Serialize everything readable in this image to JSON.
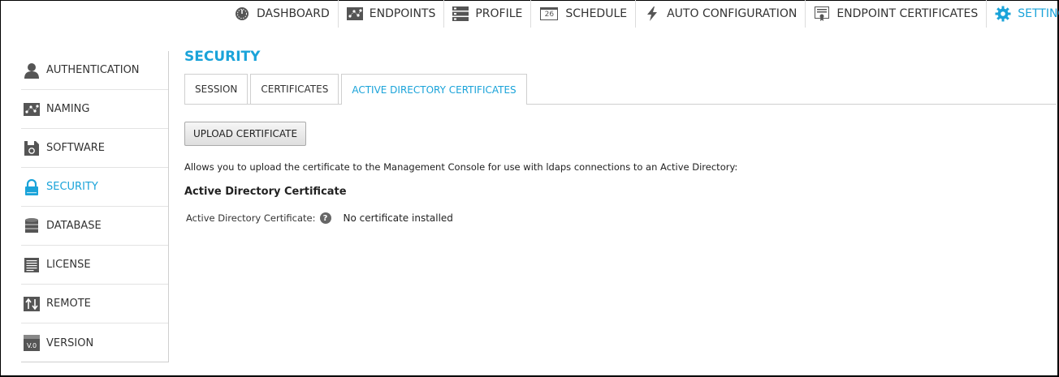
{
  "topnav": {
    "items": [
      {
        "label": "DASHBOARD",
        "icon": "dashboard-gauge-icon"
      },
      {
        "label": "ENDPOINTS",
        "icon": "endpoints-network-icon"
      },
      {
        "label": "PROFILE",
        "icon": "profile-server-icon"
      },
      {
        "label": "SCHEDULE",
        "icon": "calendar-icon",
        "icon_text": "26"
      },
      {
        "label": "AUTO CONFIGURATION",
        "icon": "lightning-bolt-icon"
      },
      {
        "label": "ENDPOINT CERTIFICATES",
        "icon": "certificate-icon"
      },
      {
        "label": "SETTINGS",
        "icon": "gear-icon",
        "active": true
      }
    ]
  },
  "sidebar": {
    "items": [
      {
        "label": "AUTHENTICATION",
        "icon": "user-icon"
      },
      {
        "label": "NAMING",
        "icon": "naming-network-icon"
      },
      {
        "label": "SOFTWARE",
        "icon": "software-disk-icon"
      },
      {
        "label": "SECURITY",
        "icon": "lock-icon",
        "active": true
      },
      {
        "label": "DATABASE",
        "icon": "database-icon"
      },
      {
        "label": "LICENSE",
        "icon": "license-document-icon"
      },
      {
        "label": "REMOTE",
        "icon": "remote-arrows-icon"
      },
      {
        "label": "VERSION",
        "icon": "version-icon",
        "icon_text": "V.0"
      }
    ]
  },
  "main": {
    "title": "SECURITY",
    "tabs": [
      {
        "label": "SESSION"
      },
      {
        "label": "CERTIFICATES"
      },
      {
        "label": "ACTIVE DIRECTORY CERTIFICATES",
        "active": true
      }
    ],
    "upload_button": "UPLOAD CERTIFICATE",
    "description": "Allows you to upload the certificate to the Management Console for use with ldaps connections to an Active Directory:",
    "section_title": "Active Directory Certificate",
    "field": {
      "label": "Active Directory Certificate:",
      "help": "?",
      "value": "No certificate installed"
    }
  },
  "colors": {
    "accent": "#1aa3d9",
    "icon_gray": "#555555"
  }
}
